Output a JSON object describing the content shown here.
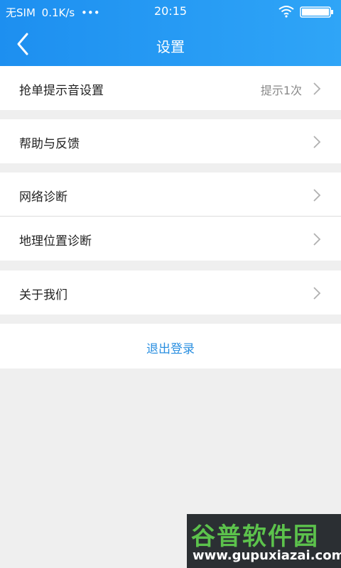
{
  "status_bar": {
    "carrier": "无SIM",
    "speed": "0.1K/s",
    "dots": "•••",
    "time": "20:15",
    "icons": [
      "wifi-icon",
      "battery-icon"
    ]
  },
  "nav": {
    "back_icon": "back-arrow-icon",
    "title": "设置"
  },
  "settings": {
    "grab_sound": {
      "label": "抢单提示音设置",
      "value": "提示1次"
    },
    "help_feedback": {
      "label": "帮助与反馈"
    },
    "network_diagnosis": {
      "label": "网络诊断"
    },
    "location_diagnosis": {
      "label": "地理位置诊断"
    },
    "about_us": {
      "label": "关于我们"
    }
  },
  "logout": {
    "label": "退出登录"
  },
  "watermark": {
    "title": "谷普软件园",
    "url": "www.gupuxiazai.com"
  },
  "colors": {
    "header_start": "#1d8ff0",
    "header_end": "#2fa5f7",
    "background": "#efefef",
    "logout_text": "#2a8fe0",
    "secondary_text": "#888888"
  }
}
